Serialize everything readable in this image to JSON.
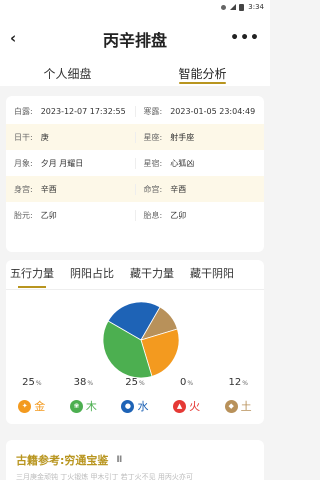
{
  "status": {
    "time": "3:34"
  },
  "header": {
    "title": "丙辛排盘"
  },
  "tabs": [
    {
      "label": "个人细盘",
      "active": false
    },
    {
      "label": "智能分析",
      "active": true
    }
  ],
  "info": {
    "rows": [
      {
        "left_label": "白露:",
        "left_value": "2023-12-07 17:32:55",
        "right_label": "寒露:",
        "right_value": "2023-01-05 23:04:49",
        "alt": false
      },
      {
        "left_label": "日干:",
        "left_value": "庚",
        "right_label": "星座:",
        "right_value": "射手座",
        "alt": true
      },
      {
        "left_label": "月象:",
        "left_value": "夕月 月耀日",
        "right_label": "星宿:",
        "right_value": "心狐凶",
        "alt": false
      },
      {
        "left_label": "身宫:",
        "left_value": "辛酉",
        "right_label": "命宫:",
        "right_value": "辛酉",
        "alt": true
      },
      {
        "left_label": "胎元:",
        "left_value": "乙卯",
        "right_label": "胎息:",
        "right_value": "乙卯",
        "alt": false
      }
    ]
  },
  "subtabs": [
    {
      "label": "五行力量",
      "active": true
    },
    {
      "label": "阴阳占比",
      "active": false
    },
    {
      "label": "藏干力量",
      "active": false
    },
    {
      "label": "藏干阴阳",
      "active": false
    }
  ],
  "chart_data": {
    "type": "pie",
    "categories": [
      "金",
      "木",
      "水",
      "火",
      "土"
    ],
    "values": [
      25,
      38,
      25,
      0,
      12
    ],
    "colors": [
      "#f39a1f",
      "#4caf50",
      "#1e63b6",
      "#e53935",
      "#b8915a"
    ],
    "unit": "%"
  },
  "elements": [
    {
      "name": "金",
      "icon": "gold-icon",
      "color": "#f39a1f",
      "glyph": "✦"
    },
    {
      "name": "木",
      "icon": "wood-icon",
      "color": "#4caf50",
      "glyph": "❀"
    },
    {
      "name": "水",
      "icon": "water-icon",
      "color": "#1e63b6",
      "glyph": "●"
    },
    {
      "name": "火",
      "icon": "fire-icon",
      "color": "#e53935",
      "glyph": "▲"
    },
    {
      "name": "土",
      "icon": "earth-icon",
      "color": "#b8915a",
      "glyph": "◆"
    }
  ],
  "reference": {
    "title": "古籍参考:穷通宝鉴",
    "faint_text": "三月庚金顽钝 丁火锻炼 甲木引丁 若丁火不见 用丙火亦可"
  },
  "colors": {
    "accent": "#b8951f",
    "alt_row": "#fdf8e8"
  }
}
